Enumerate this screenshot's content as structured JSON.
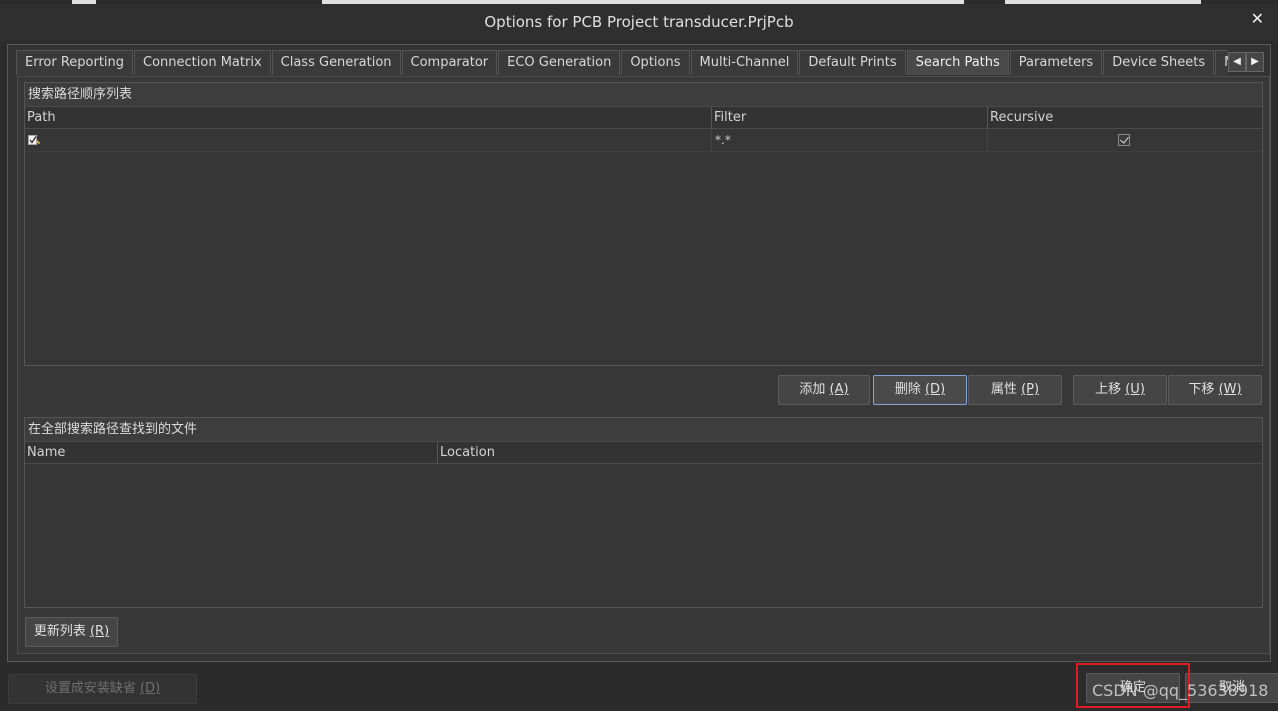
{
  "window": {
    "title": "Options for PCB Project transducer.PrjPcb",
    "close_glyph": "✕"
  },
  "tabs": [
    {
      "label": "Error Reporting"
    },
    {
      "label": "Connection Matrix"
    },
    {
      "label": "Class Generation"
    },
    {
      "label": "Comparator"
    },
    {
      "label": "ECO Generation"
    },
    {
      "label": "Options"
    },
    {
      "label": "Multi-Channel"
    },
    {
      "label": "Default Prints"
    },
    {
      "label": "Search Paths",
      "active": true
    },
    {
      "label": "Parameters"
    },
    {
      "label": "Device Sheets"
    },
    {
      "label": "Managed Outp"
    }
  ],
  "tab_arrows": {
    "left": "◀",
    "right": "▶"
  },
  "search_order": {
    "title": "搜索路径顺序列表",
    "columns": [
      "Path",
      "Filter",
      "Recursive"
    ],
    "rows": [
      {
        "path": "",
        "filter": "*.*",
        "recursive": true
      }
    ]
  },
  "path_buttons": {
    "add": {
      "text": "添加 ",
      "key": "(A)"
    },
    "remove": {
      "text": "删除 ",
      "key": "(D)"
    },
    "properties": {
      "text": "属性 ",
      "key": "(P)"
    },
    "move_up": {
      "text": "上移 ",
      "key": "(U)"
    },
    "move_down": {
      "text": "下移 ",
      "key": "(W)"
    }
  },
  "found_files": {
    "title": "在全部搜索路径查找到的文件",
    "columns": [
      "Name",
      "Location"
    ]
  },
  "refresh_button": {
    "text": "更新列表 ",
    "key": "(R)"
  },
  "footer": {
    "set_default": {
      "text": "设置成安装缺省 ",
      "key": "(D)"
    },
    "ok": "确定",
    "cancel": "取消"
  },
  "watermark": "CSDN @qq_53638918",
  "colors": {
    "highlight_border": "#e01b24",
    "focus_border": "#7fa8d8"
  }
}
